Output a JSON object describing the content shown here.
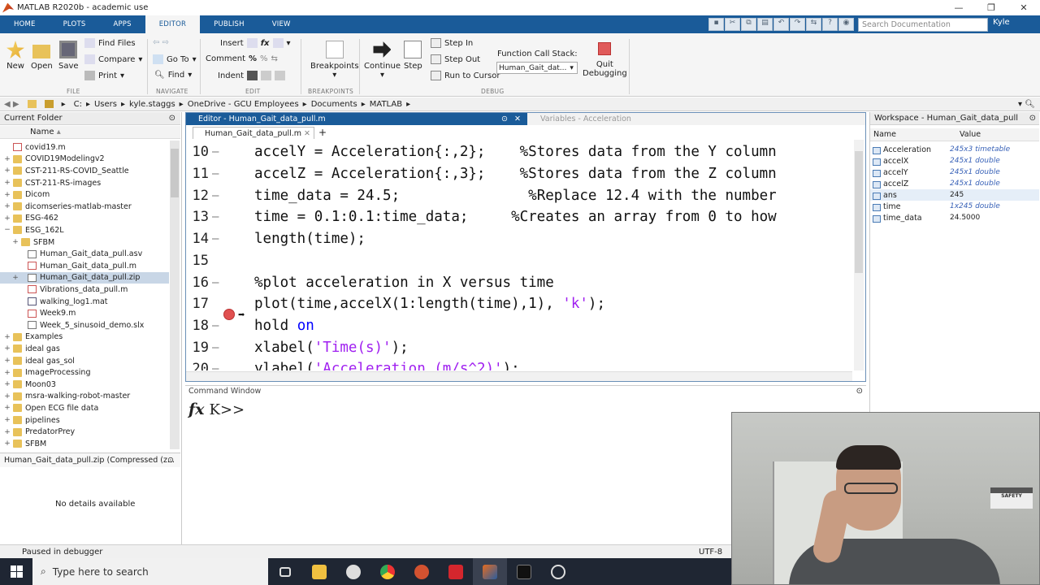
{
  "window": {
    "title": "MATLAB R2020b - academic use"
  },
  "tabs": [
    "HOME",
    "PLOTS",
    "APPS",
    "EDITOR",
    "PUBLISH",
    "VIEW"
  ],
  "active_tab": "EDITOR",
  "search": {
    "placeholder": "Search Documentation"
  },
  "user": "Kyle",
  "ribbon": {
    "file": {
      "new": "New",
      "open": "Open",
      "save": "Save",
      "find_files": "Find Files",
      "compare": "Compare",
      "print": "Print",
      "label": "FILE"
    },
    "navigate": {
      "goto": "Go To",
      "find": "Find",
      "label": "NAVIGATE"
    },
    "edit": {
      "insert": "Insert",
      "comment": "Comment",
      "indent": "Indent",
      "label": "EDIT"
    },
    "breakpoints": {
      "breakpoints": "Breakpoints",
      "label": "BREAKPOINTS"
    },
    "debug": {
      "continue": "Continue",
      "step": "Step",
      "step_in": "Step In",
      "step_out": "Step Out",
      "run_to_cursor": "Run to Cursor",
      "call_stack_label": "Function Call Stack:",
      "call_stack_value": "Human_Gait_dat...",
      "quit": "Quit",
      "quit2": "Debugging",
      "label": "DEBUG"
    }
  },
  "address": [
    "C:",
    "Users",
    "kyle.staggs",
    "OneDrive - GCU Employees",
    "Documents",
    "MATLAB"
  ],
  "current_folder": {
    "title": "Current Folder",
    "header": "Name",
    "items": [
      {
        "name": "covid19.m",
        "type": "m",
        "plus": ""
      },
      {
        "name": "COVID19Modelingv2",
        "type": "folder",
        "plus": "+"
      },
      {
        "name": "CST-211-RS-COVID_Seattle",
        "type": "folder",
        "plus": "+"
      },
      {
        "name": "CST-211-RS-images",
        "type": "folder",
        "plus": "+"
      },
      {
        "name": "Dicom",
        "type": "folder",
        "plus": "+"
      },
      {
        "name": "dicomseries-matlab-master",
        "type": "folder",
        "plus": "+"
      },
      {
        "name": "ESG-462",
        "type": "folder",
        "plus": "+"
      },
      {
        "name": "ESG_162L",
        "type": "folder",
        "plus": "−"
      },
      {
        "name": "SFBM",
        "type": "folder",
        "plus": "+"
      },
      {
        "name": "Human_Gait_data_pull.asv",
        "type": "zip",
        "plus": ""
      },
      {
        "name": "Human_Gait_data_pull.m",
        "type": "m",
        "plus": ""
      },
      {
        "name": "Human_Gait_data_pull.zip",
        "type": "zip",
        "plus": "+"
      },
      {
        "name": "Vibrations_data_pull.m",
        "type": "m",
        "plus": ""
      },
      {
        "name": "walking_log1.mat",
        "type": "mat",
        "plus": ""
      },
      {
        "name": "Week9.m",
        "type": "m",
        "plus": ""
      },
      {
        "name": "Week_5_sinusoid_demo.slx",
        "type": "zip",
        "plus": ""
      },
      {
        "name": "Examples",
        "type": "folder",
        "plus": "+"
      },
      {
        "name": "ideal gas",
        "type": "folder",
        "plus": "+"
      },
      {
        "name": "ideal gas_sol",
        "type": "folder",
        "plus": "+"
      },
      {
        "name": "ImageProcessing",
        "type": "folder",
        "plus": "+"
      },
      {
        "name": "Moon03",
        "type": "folder",
        "plus": "+"
      },
      {
        "name": "msra-walking-robot-master",
        "type": "folder",
        "plus": "+"
      },
      {
        "name": "Open ECG file data",
        "type": "folder",
        "plus": "+"
      },
      {
        "name": "pipelines",
        "type": "folder",
        "plus": "+"
      },
      {
        "name": "PredatorPrey",
        "type": "folder",
        "plus": "+"
      },
      {
        "name": "SFBM",
        "type": "folder",
        "plus": "+"
      }
    ],
    "selected_index": 11,
    "detail_title": "Human_Gait_data_pull.zip (Compressed (z...",
    "no_details": "No details available"
  },
  "editor": {
    "title": "Editor - Human_Gait_data_pull.m",
    "variables_tab": "Variables - Acceleration",
    "file_tab": "Human_Gait_data_pull.m",
    "lines": [
      {
        "n": "10",
        "code": "accelY = Acceleration{:,2};    ",
        "comment": "%Stores data from the Y column"
      },
      {
        "n": "11",
        "code": "accelZ = Acceleration{:,3};    ",
        "comment": "%Stores data from the Z column"
      },
      {
        "n": "12",
        "code": "time_data = 24.5;               ",
        "comment": "%Replace 12.4 with the number"
      },
      {
        "n": "13",
        "code": "time = 0.1:0.1:time_data;     ",
        "comment": "%Creates an array from 0 to how"
      },
      {
        "n": "14",
        "code": "length(time);",
        "comment": ""
      },
      {
        "n": "15",
        "code": "",
        "comment": ""
      },
      {
        "n": "16",
        "code": "",
        "comment": "%plot acceleration in X versus time"
      },
      {
        "n": "17",
        "code": "plot(time,accelX(1:length(time),1), ",
        "str": "'k'",
        "tail": ");"
      },
      {
        "n": "18",
        "code": "hold ",
        "kw": "on"
      },
      {
        "n": "19",
        "code": "xlabel(",
        "str": "'Time(s)'",
        "tail": ");"
      },
      {
        "n": "20",
        "code": "ylabel(",
        "str": "'Acceleration (m/s^2)'",
        "tail": ");"
      }
    ]
  },
  "command_window": {
    "title": "Command Window",
    "fx": "fx",
    "prompt": "K>>"
  },
  "workspace": {
    "title": "Workspace - Human_Gait_data_pull",
    "col_name": "Name",
    "col_value": "Value",
    "vars": [
      {
        "name": "Acceleration",
        "value": "245x3 timetable",
        "italic": true
      },
      {
        "name": "accelX",
        "value": "245x1 double",
        "italic": true
      },
      {
        "name": "accelY",
        "value": "245x1 double",
        "italic": true
      },
      {
        "name": "accelZ",
        "value": "245x1 double",
        "italic": true
      },
      {
        "name": "ans",
        "value": "245",
        "italic": false
      },
      {
        "name": "time",
        "value": "1x245 double",
        "italic": true
      },
      {
        "name": "time_data",
        "value": "24.5000",
        "italic": false
      }
    ]
  },
  "status": {
    "left": "Paused in debugger",
    "encoding": "UTF-8"
  },
  "taskbar": {
    "search_placeholder": "Type here to search"
  },
  "webcam": {
    "sign": "SAFETY"
  }
}
